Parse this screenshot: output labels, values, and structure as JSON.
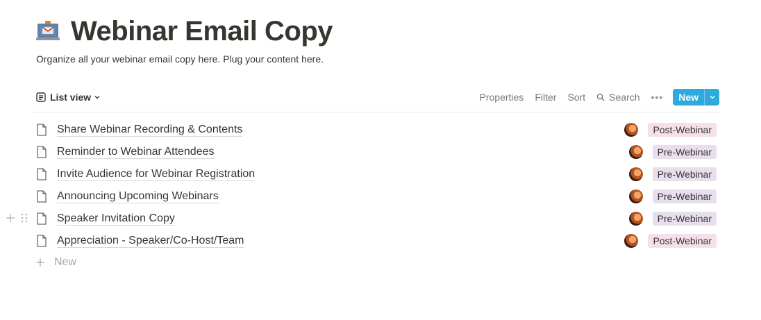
{
  "page": {
    "title": "Webinar Email Copy",
    "description": "Organize all your webinar email copy here. Plug your content here.",
    "icon": "laptop-envelope-icon"
  },
  "toolbar": {
    "view_label": "List view",
    "properties_label": "Properties",
    "filter_label": "Filter",
    "sort_label": "Sort",
    "search_label": "Search",
    "new_label": "New"
  },
  "rows": [
    {
      "title": "Share Webinar Recording & Contents",
      "tag": "Post-Webinar"
    },
    {
      "title": "Reminder to Webinar Attendees",
      "tag": "Pre-Webinar"
    },
    {
      "title": "Invite Audience for Webinar Registration",
      "tag": "Pre-Webinar"
    },
    {
      "title": "Announcing Upcoming Webinars",
      "tag": "Pre-Webinar"
    },
    {
      "title": "Speaker Invitation Copy",
      "tag": "Pre-Webinar"
    },
    {
      "title": "Appreciation - Speaker/Co-Host/Team",
      "tag": "Post-Webinar"
    }
  ],
  "new_row_label": "New",
  "colors": {
    "accent": "#2eaadc",
    "post_tag_bg": "#f5e0e9",
    "pre_tag_bg": "#e8deee",
    "text": "#37352f",
    "muted": "#787774"
  }
}
